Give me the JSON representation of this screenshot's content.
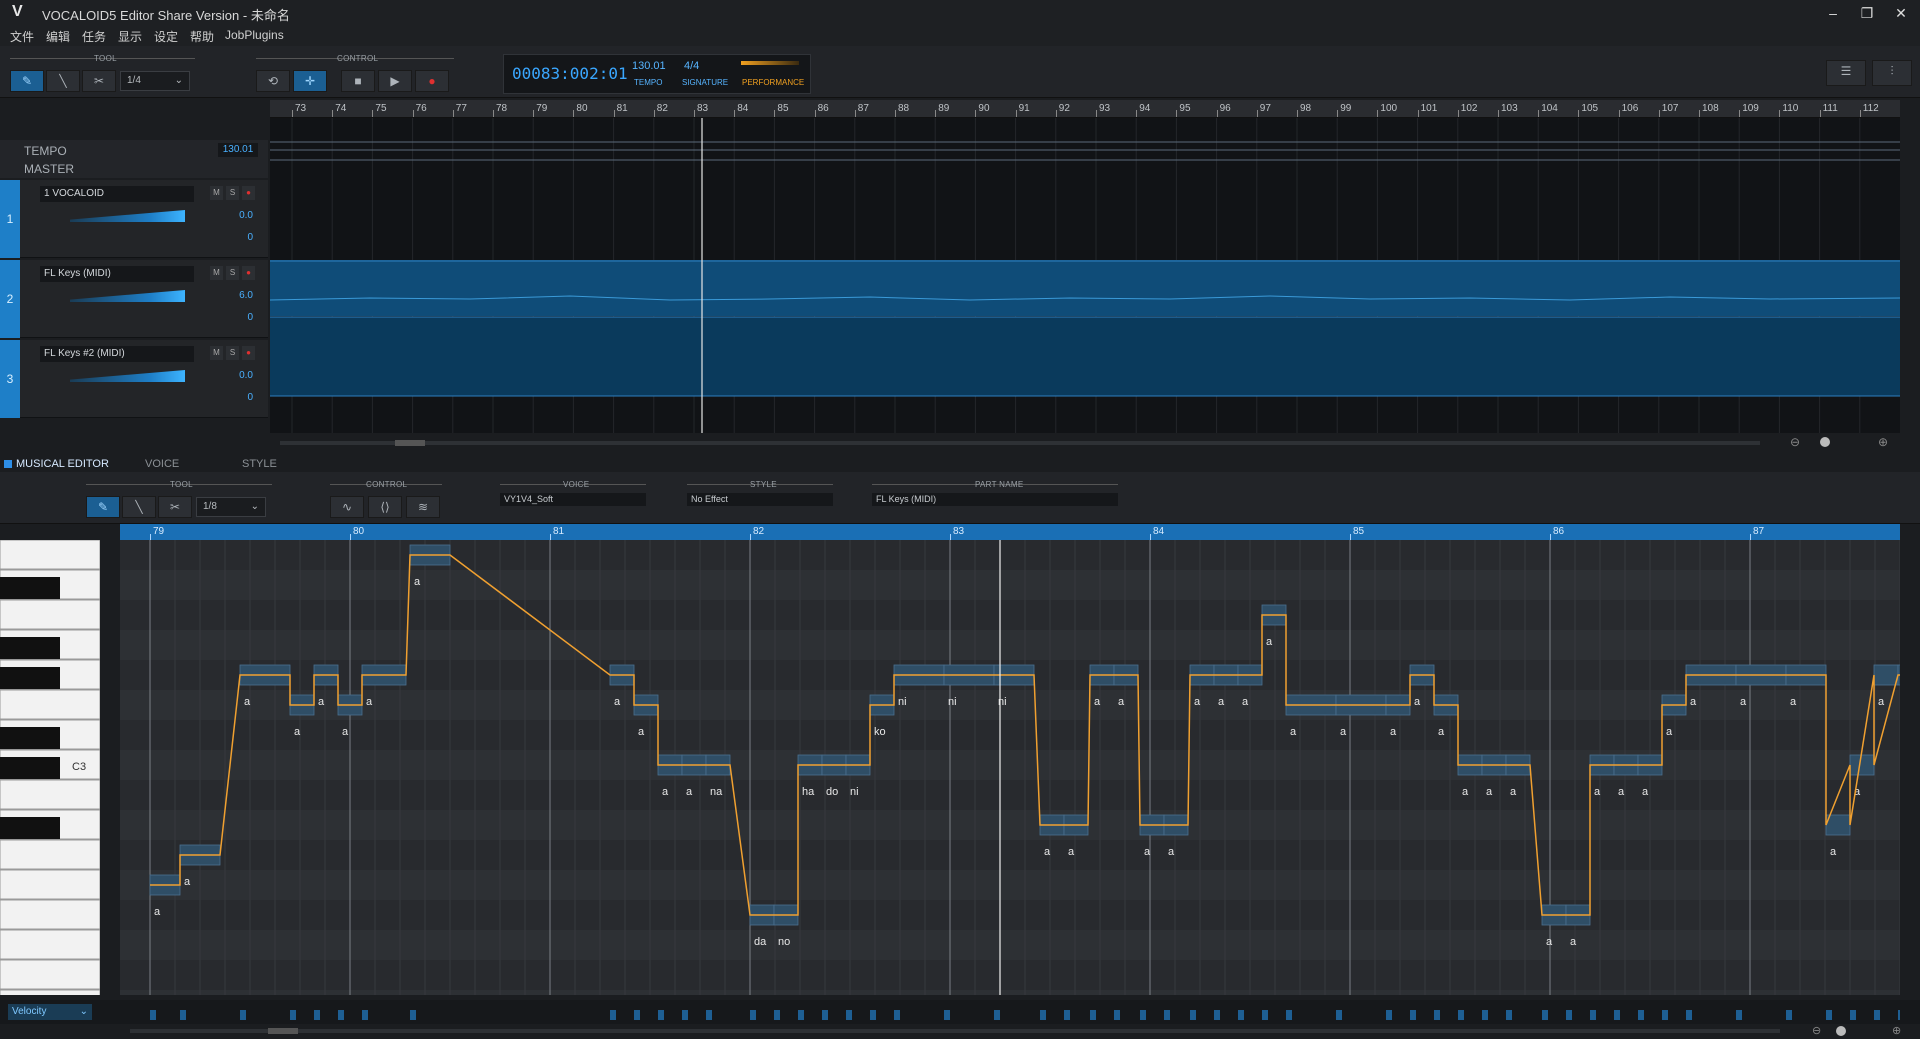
{
  "window": {
    "logo": "V",
    "title": "VOCALOID5 Editor Share Version - 未命名",
    "minimize": "–",
    "maximize": "❐",
    "close": "✕"
  },
  "menu": [
    "文件",
    "编辑",
    "任务",
    "显示",
    "设定",
    "帮助",
    "JobPlugins"
  ],
  "toolbar": {
    "tool_label": "TOOL",
    "control_label": "CONTROL",
    "quantize": "1/4",
    "counter": "00083:002:01",
    "tempo_value": "130.01",
    "tempo_label": "TEMPO",
    "signature_value": "4/4",
    "signature_label": "SIGNATURE",
    "performance_label": "PERFORMANCE"
  },
  "arrangement": {
    "tempo_label": "TEMPO",
    "tempo_value": "130.01",
    "master_label": "MASTER",
    "ruler_start": 73,
    "ruler_end": 112,
    "tracks": [
      {
        "num": "1",
        "name": "1 VOCALOID",
        "volume": "0.0",
        "pan": "0"
      },
      {
        "num": "2",
        "name": "FL Keys (MIDI)",
        "volume": "6.0",
        "pan": "0"
      },
      {
        "num": "3",
        "name": "FL Keys #2 (MIDI)",
        "volume": "0.0",
        "pan": "0"
      }
    ]
  },
  "editor": {
    "tabs": [
      "MUSICAL EDITOR",
      "VOICE",
      "STYLE"
    ],
    "tool_label": "TOOL",
    "control_label": "CONTROL",
    "quantize": "1/8",
    "voice_label": "VOICE",
    "voice_value": "VY1V4_Soft",
    "style_label": "STYLE",
    "style_value": "No Effect",
    "part_label": "PART NAME",
    "part_value": "FL Keys (MIDI)",
    "ruler": [
      "79",
      "80",
      "81",
      "82",
      "83",
      "84",
      "85",
      "86",
      "87"
    ],
    "c3_label": "C3",
    "velocity_label": "Velocity",
    "notes": [
      {
        "row": 11,
        "start": 0.0,
        "len": 0.15,
        "lyric": "a"
      },
      {
        "row": 10,
        "start": 0.15,
        "len": 0.2,
        "lyric": "a"
      },
      {
        "row": 0,
        "start": 1.3,
        "len": 0.2,
        "lyric": "a"
      },
      {
        "row": 4,
        "start": 0.45,
        "len": 0.25,
        "lyric": "a"
      },
      {
        "row": 5,
        "start": 0.7,
        "len": 0.12,
        "lyric": "a"
      },
      {
        "row": 4,
        "start": 0.82,
        "len": 0.12,
        "lyric": "a"
      },
      {
        "row": 5,
        "start": 0.94,
        "len": 0.12,
        "lyric": "a"
      },
      {
        "row": 4,
        "start": 1.06,
        "len": 0.22,
        "lyric": "a"
      },
      {
        "row": 4,
        "start": 2.3,
        "len": 0.12,
        "lyric": "a"
      },
      {
        "row": 5,
        "start": 2.42,
        "len": 0.12,
        "lyric": "a"
      },
      {
        "row": 7,
        "start": 2.54,
        "len": 0.12,
        "lyric": "a"
      },
      {
        "row": 7,
        "start": 2.66,
        "len": 0.12,
        "lyric": "a"
      },
      {
        "row": 7,
        "start": 2.78,
        "len": 0.12,
        "lyric": "na"
      },
      {
        "row": 12,
        "start": 3.0,
        "len": 0.12,
        "lyric": "da"
      },
      {
        "row": 12,
        "start": 3.12,
        "len": 0.12,
        "lyric": "no"
      },
      {
        "row": 7,
        "start": 3.24,
        "len": 0.12,
        "lyric": "ha"
      },
      {
        "row": 7,
        "start": 3.36,
        "len": 0.12,
        "lyric": "do"
      },
      {
        "row": 7,
        "start": 3.48,
        "len": 0.12,
        "lyric": "ni"
      },
      {
        "row": 5,
        "start": 3.6,
        "len": 0.12,
        "lyric": "ko"
      },
      {
        "row": 4,
        "start": 3.72,
        "len": 0.25,
        "lyric": "ni"
      },
      {
        "row": 4,
        "start": 3.97,
        "len": 0.25,
        "lyric": "ni"
      },
      {
        "row": 4,
        "start": 4.22,
        "len": 0.2,
        "lyric": "ni"
      },
      {
        "row": 9,
        "start": 4.45,
        "len": 0.12,
        "lyric": "a"
      },
      {
        "row": 9,
        "start": 4.57,
        "len": 0.12,
        "lyric": "a"
      },
      {
        "row": 4,
        "start": 4.7,
        "len": 0.12,
        "lyric": "a"
      },
      {
        "row": 4,
        "start": 4.82,
        "len": 0.12,
        "lyric": "a"
      },
      {
        "row": 9,
        "start": 4.95,
        "len": 0.12,
        "lyric": "a"
      },
      {
        "row": 9,
        "start": 5.07,
        "len": 0.12,
        "lyric": "a"
      },
      {
        "row": 4,
        "start": 5.2,
        "len": 0.12,
        "lyric": "a"
      },
      {
        "row": 4,
        "start": 5.32,
        "len": 0.12,
        "lyric": "a"
      },
      {
        "row": 4,
        "start": 5.44,
        "len": 0.12,
        "lyric": "a"
      },
      {
        "row": 2,
        "start": 5.56,
        "len": 0.12,
        "lyric": "a"
      },
      {
        "row": 5,
        "start": 5.68,
        "len": 0.25,
        "lyric": "a"
      },
      {
        "row": 5,
        "start": 5.93,
        "len": 0.25,
        "lyric": "a"
      },
      {
        "row": 5,
        "start": 6.18,
        "len": 0.12,
        "lyric": "a"
      },
      {
        "row": 4,
        "start": 6.3,
        "len": 0.12,
        "lyric": "a"
      },
      {
        "row": 5,
        "start": 6.42,
        "len": 0.12,
        "lyric": "a"
      },
      {
        "row": 7,
        "start": 6.54,
        "len": 0.12,
        "lyric": "a"
      },
      {
        "row": 7,
        "start": 6.66,
        "len": 0.12,
        "lyric": "a"
      },
      {
        "row": 7,
        "start": 6.78,
        "len": 0.12,
        "lyric": "a"
      },
      {
        "row": 12,
        "start": 6.96,
        "len": 0.12,
        "lyric": "a"
      },
      {
        "row": 12,
        "start": 7.08,
        "len": 0.12,
        "lyric": "a"
      },
      {
        "row": 7,
        "start": 7.2,
        "len": 0.12,
        "lyric": "a"
      },
      {
        "row": 7,
        "start": 7.32,
        "len": 0.12,
        "lyric": "a"
      },
      {
        "row": 7,
        "start": 7.44,
        "len": 0.12,
        "lyric": "a"
      },
      {
        "row": 5,
        "start": 7.56,
        "len": 0.12,
        "lyric": "a"
      },
      {
        "row": 4,
        "start": 7.68,
        "len": 0.25,
        "lyric": "a"
      },
      {
        "row": 4,
        "start": 7.93,
        "len": 0.25,
        "lyric": "a"
      },
      {
        "row": 4,
        "start": 8.18,
        "len": 0.2,
        "lyric": "a"
      },
      {
        "row": 9,
        "start": 8.38,
        "len": 0.12,
        "lyric": "a"
      },
      {
        "row": 7,
        "start": 8.5,
        "len": 0.12,
        "lyric": "a"
      },
      {
        "row": 4,
        "start": 8.62,
        "len": 0.12,
        "lyric": "a"
      },
      {
        "row": 4,
        "start": 8.74,
        "len": 0.12,
        "lyric": "a"
      }
    ]
  }
}
